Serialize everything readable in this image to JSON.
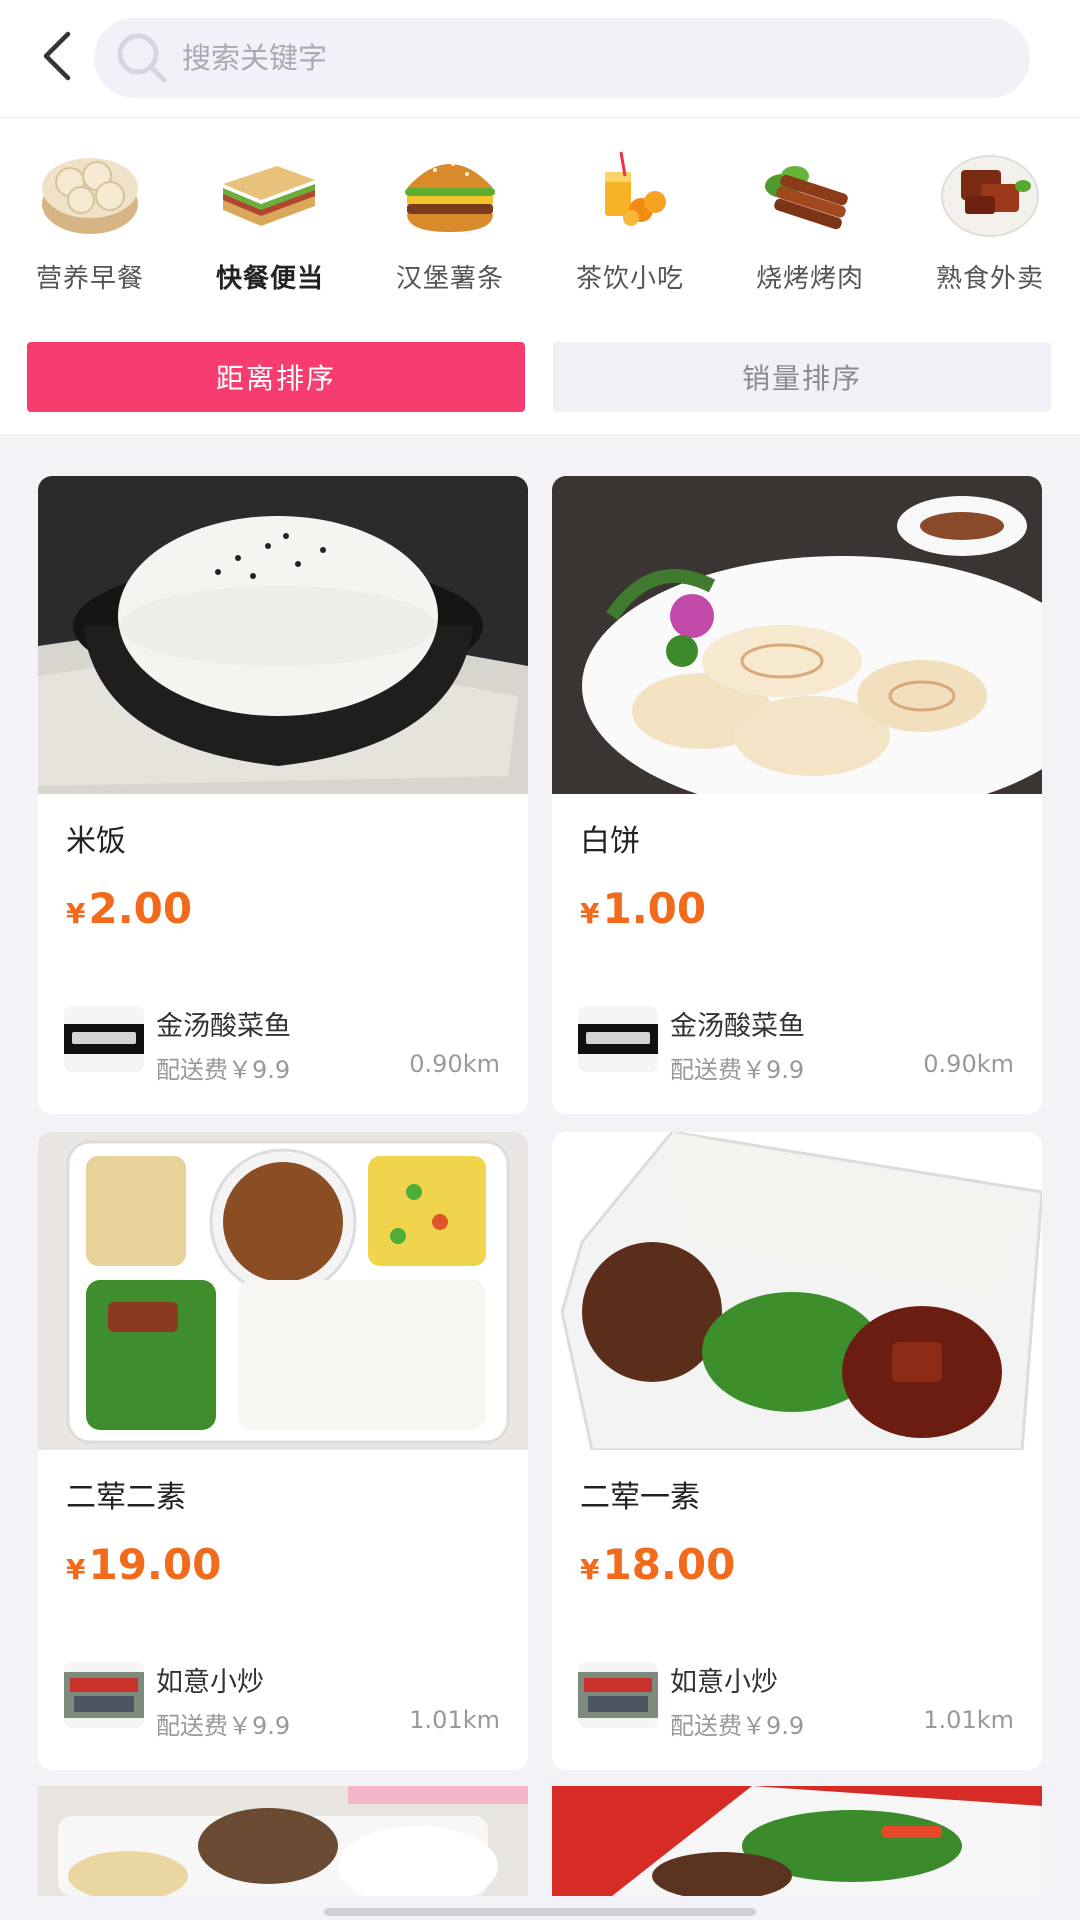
{
  "search": {
    "placeholder": "搜索关键字"
  },
  "categories": [
    {
      "label": "营养早餐",
      "active": false,
      "icon": "dim-sum-icon"
    },
    {
      "label": "快餐便当",
      "active": true,
      "icon": "sandwich-icon"
    },
    {
      "label": "汉堡薯条",
      "active": false,
      "icon": "burger-icon"
    },
    {
      "label": "茶饮小吃",
      "active": false,
      "icon": "juice-icon"
    },
    {
      "label": "烧烤烤肉",
      "active": false,
      "icon": "skewer-icon"
    },
    {
      "label": "熟食外卖",
      "active": false,
      "icon": "braised-meat-icon"
    }
  ],
  "sort": {
    "distance": "距离排序",
    "sales": "销量排序"
  },
  "products": [
    {
      "name": "米饭",
      "currency": "¥",
      "price": "2.00",
      "shop": "金汤酸菜鱼",
      "fee": "配送费￥9.9",
      "distance": "0.90km"
    },
    {
      "name": "白饼",
      "currency": "¥",
      "price": "1.00",
      "shop": "金汤酸菜鱼",
      "fee": "配送费￥9.9",
      "distance": "0.90km"
    },
    {
      "name": "二荤二素",
      "currency": "¥",
      "price": "19.00",
      "shop": "如意小炒",
      "fee": "配送费￥9.9",
      "distance": "1.01km"
    },
    {
      "name": "二荤一素",
      "currency": "¥",
      "price": "18.00",
      "shop": "如意小炒",
      "fee": "配送费￥9.9",
      "distance": "1.01km"
    }
  ],
  "colors": {
    "accent": "#f73c6f",
    "price": "#f26a1b"
  }
}
